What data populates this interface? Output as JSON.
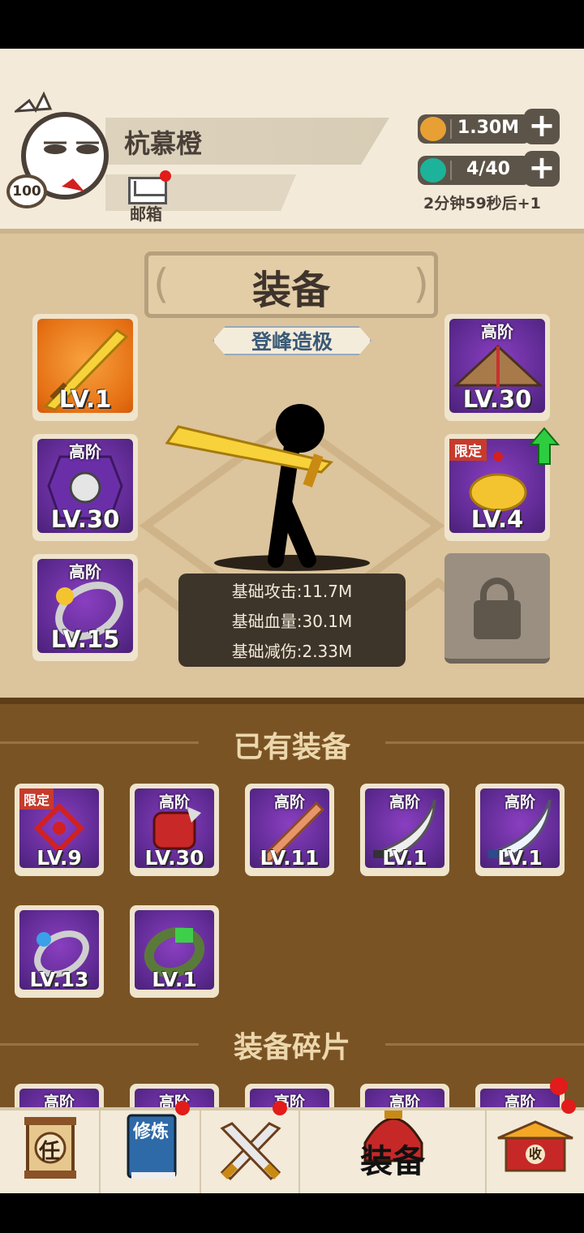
{
  "player": {
    "name": "杭慕橙",
    "level": "100",
    "mail_label": "邮箱"
  },
  "resources": {
    "coins": "1.30M",
    "gems": "4/40",
    "timer": "2分钟59秒后+1"
  },
  "equipment": {
    "title": "装备",
    "rank": "登峰造极",
    "left_slots": [
      {
        "tier": "",
        "level": "LV.1",
        "kind": "sword",
        "bg": "orange"
      },
      {
        "tier": "高阶",
        "level": "LV.30",
        "kind": "armor",
        "bg": "purple"
      },
      {
        "tier": "高阶",
        "level": "LV.15",
        "kind": "ring",
        "bg": "purple"
      }
    ],
    "right_slots": [
      {
        "tier": "高阶",
        "level": "LV.30",
        "kind": "hat",
        "bg": "purple"
      },
      {
        "tier": "限定",
        "level": "LV.4",
        "kind": "ingot",
        "bg": "purple"
      }
    ],
    "stats": [
      "基础攻击:11.7M",
      "基础血量:30.1M",
      "基础减伤:2.33M"
    ]
  },
  "owned": {
    "title": "已有装备",
    "items": [
      {
        "tier": "限定",
        "level": "LV.9",
        "kind": "knot"
      },
      {
        "tier": "高阶",
        "level": "LV.30",
        "kind": "gauntlet"
      },
      {
        "tier": "高阶",
        "level": "LV.11",
        "kind": "copper-sword"
      },
      {
        "tier": "高阶",
        "level": "LV.1",
        "kind": "blade"
      },
      {
        "tier": "高阶",
        "level": "LV.1",
        "kind": "blade-blue"
      },
      {
        "tier": "",
        "level": "LV.13",
        "kind": "ring-blue"
      },
      {
        "tier": "",
        "level": "LV.1",
        "kind": "jade-ring"
      }
    ]
  },
  "fragments": {
    "title": "装备碎片",
    "tiers": [
      "高阶",
      "高阶",
      "高阶",
      "高阶",
      "高阶"
    ]
  },
  "nav": {
    "task_label": "任",
    "train_label": "修炼",
    "equip_label": "装备",
    "collect_label": "收"
  },
  "colors": {
    "accent_purple": "#5e2a92",
    "badge_red": "#e21b1b",
    "panel_tan": "#dcc49c",
    "bag_brown": "#7a5324"
  }
}
